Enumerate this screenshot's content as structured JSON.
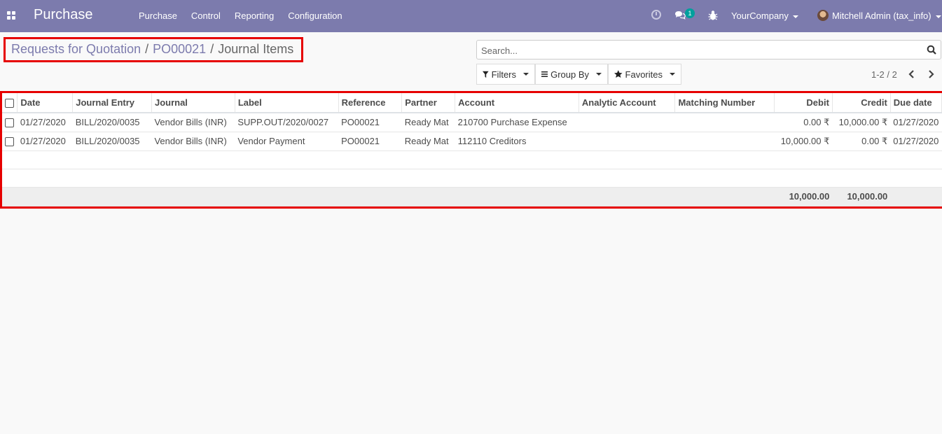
{
  "navbar": {
    "brand": "Purchase",
    "menu": [
      "Purchase",
      "Control",
      "Reporting",
      "Configuration"
    ],
    "chat_badge": "1",
    "company": "YourCompany",
    "user": "Mitchell Admin (tax_info)"
  },
  "breadcrumb": {
    "items": [
      "Requests for Quotation",
      "PO00021"
    ],
    "active": "Journal Items"
  },
  "search": {
    "placeholder": "Search..."
  },
  "buttons": {
    "filters": "Filters",
    "group_by": "Group By",
    "favorites": "Favorites"
  },
  "pager": "1-2 / 2",
  "table": {
    "columns": [
      "Date",
      "Journal Entry",
      "Journal",
      "Label",
      "Reference",
      "Partner",
      "Account",
      "Analytic Account",
      "Matching Number",
      "Debit",
      "Credit",
      "Due date"
    ],
    "rows": [
      [
        "01/27/2020",
        "BILL/2020/0035",
        "Vendor Bills (INR)",
        "SUPP.OUT/2020/0027",
        "PO00021",
        "Ready Mat",
        "210700 Purchase Expense",
        "",
        "",
        "0.00 ₹",
        "10,000.00 ₹",
        "01/27/2020"
      ],
      [
        "01/27/2020",
        "BILL/2020/0035",
        "Vendor Bills (INR)",
        "Vendor Payment",
        "PO00021",
        "Ready Mat",
        "112110 Creditors",
        "",
        "",
        "10,000.00 ₹",
        "0.00 ₹",
        "01/27/2020"
      ]
    ],
    "totals": {
      "debit": "10,000.00",
      "credit": "10,000.00"
    }
  }
}
